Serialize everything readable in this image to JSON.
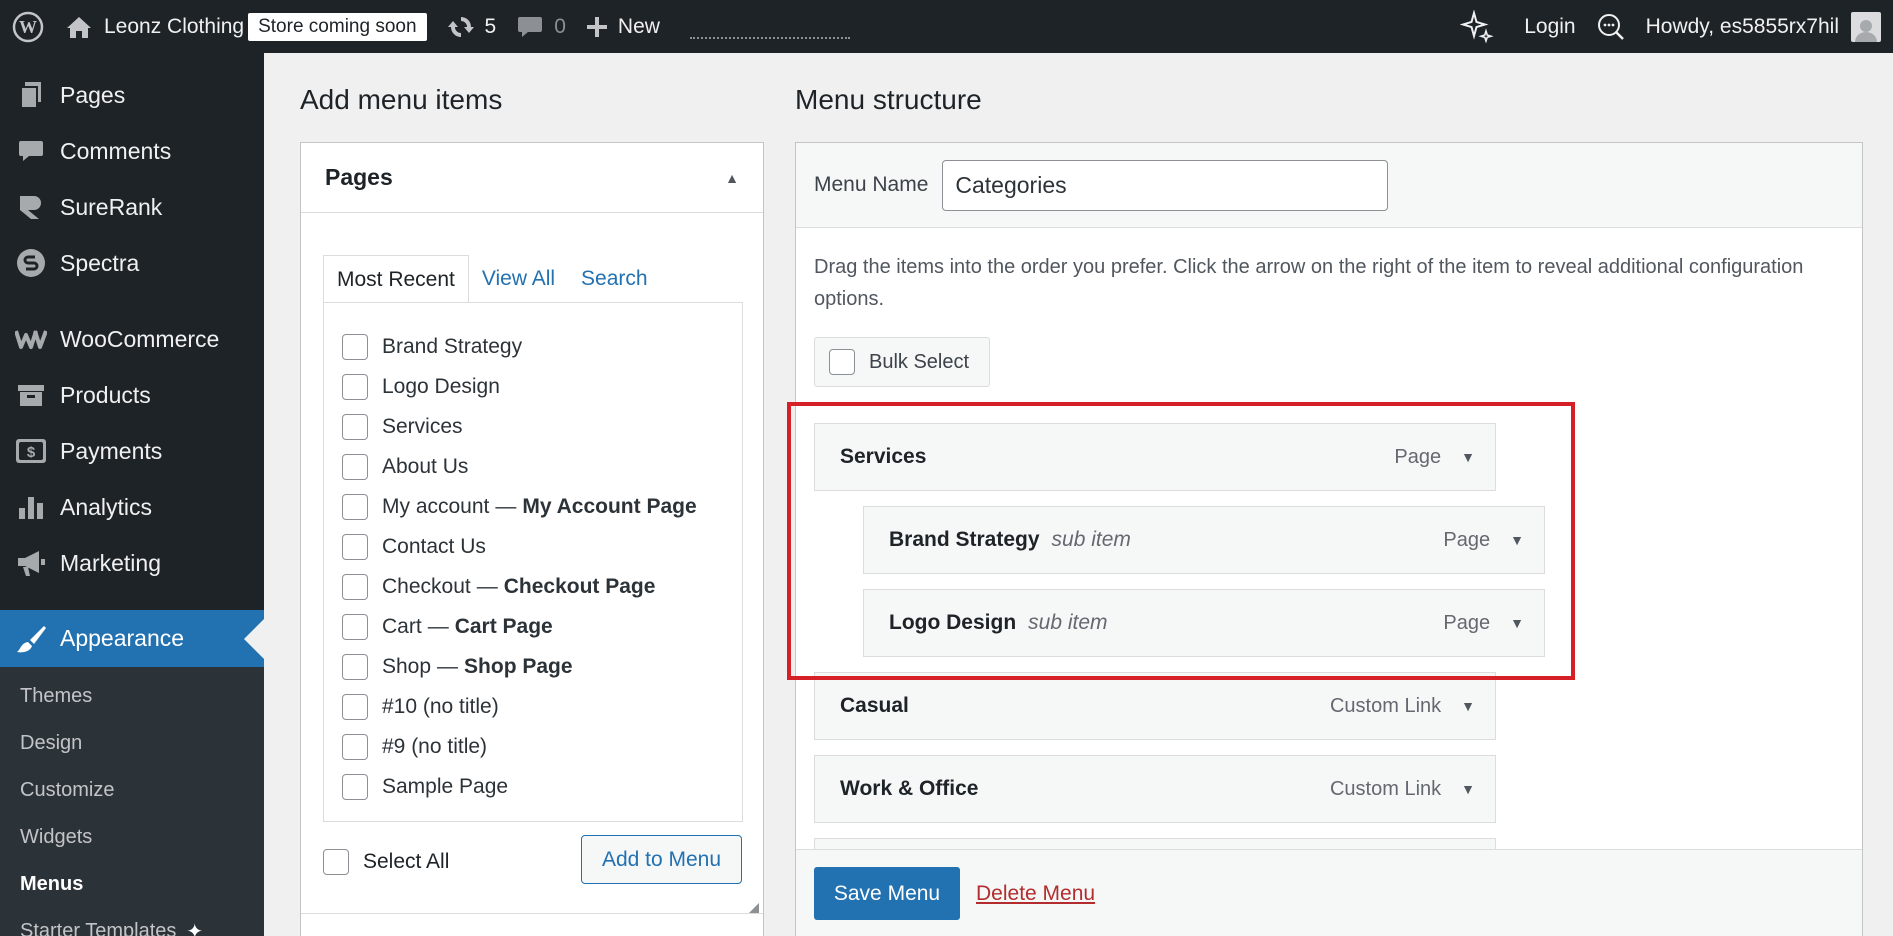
{
  "adminbar": {
    "site_name": "Leonz Clothing",
    "store_badge": "Store coming soon",
    "updates_count": "5",
    "comments_count": "0",
    "new_label": "New",
    "login_label": "Login",
    "howdy": "Howdy, es5855rx7hil"
  },
  "sidebar": {
    "items": [
      {
        "label": "Pages",
        "icon": "pages-icon"
      },
      {
        "label": "Comments",
        "icon": "comments-icon"
      },
      {
        "label": "SureRank",
        "icon": "surerank-icon"
      },
      {
        "label": "Spectra",
        "icon": "spectra-icon"
      },
      {
        "label": "WooCommerce",
        "icon": "woocommerce-icon"
      },
      {
        "label": "Products",
        "icon": "products-icon"
      },
      {
        "label": "Payments",
        "icon": "payments-icon"
      },
      {
        "label": "Analytics",
        "icon": "analytics-icon"
      },
      {
        "label": "Marketing",
        "icon": "marketing-icon"
      }
    ],
    "current": {
      "label": "Appearance",
      "icon": "paintbrush-icon"
    },
    "submenu": [
      "Themes",
      "Design",
      "Customize",
      "Widgets",
      "Menus",
      "Starter Templates"
    ]
  },
  "add_menu_items": {
    "title": "Add menu items",
    "panel_title": "Pages",
    "tabs": [
      "Most Recent",
      "View All",
      "Search"
    ],
    "pages": [
      {
        "label": "Brand Strategy",
        "suffix": ""
      },
      {
        "label": "Logo Design",
        "suffix": ""
      },
      {
        "label": "Services",
        "suffix": ""
      },
      {
        "label": "About Us",
        "suffix": ""
      },
      {
        "label": "My account",
        "suffix": "My Account Page"
      },
      {
        "label": "Contact Us",
        "suffix": ""
      },
      {
        "label": "Checkout",
        "suffix": "Checkout Page"
      },
      {
        "label": "Cart",
        "suffix": "Cart Page"
      },
      {
        "label": "Shop",
        "suffix": "Shop Page"
      },
      {
        "label": "#10 (no title)",
        "suffix": ""
      },
      {
        "label": "#9 (no title)",
        "suffix": ""
      },
      {
        "label": "Sample Page",
        "suffix": ""
      }
    ],
    "separator": "—",
    "select_all": "Select All",
    "add_button": "Add to Menu"
  },
  "menu_structure": {
    "title": "Menu structure",
    "menu_name_label": "Menu Name",
    "menu_name_value": "Categories",
    "instructions": "Drag the items into the order you prefer. Click the arrow on the right of the item to reveal additional configuration options.",
    "bulk_select": "Bulk Select",
    "items": [
      {
        "title": "Services",
        "sub": "",
        "type": "Page"
      },
      {
        "title": "Brand Strategy",
        "sub": "sub item",
        "type": "Page"
      },
      {
        "title": "Logo Design",
        "sub": "sub item",
        "type": "Page"
      },
      {
        "title": "Casual",
        "sub": "",
        "type": "Custom Link"
      },
      {
        "title": "Work & Office",
        "sub": "",
        "type": "Custom Link"
      }
    ],
    "save_button": "Save Menu",
    "delete_link": "Delete Menu",
    "highlight_color": "#d52027"
  }
}
